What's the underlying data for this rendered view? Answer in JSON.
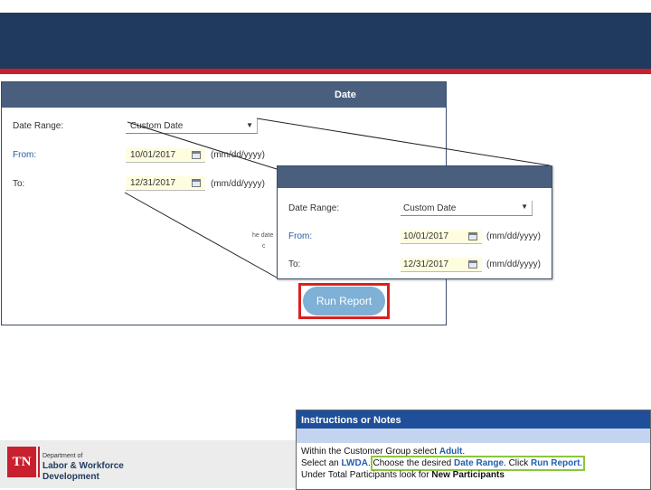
{
  "main_form": {
    "title": "Date",
    "date_range_label": "Date Range:",
    "date_range_value": "Custom Date",
    "from_label": "From:",
    "from_value": "10/01/2017",
    "to_label": "To:",
    "to_value": "12/31/2017",
    "date_format": "(mm/dd/yyyy)",
    "partial_text_1": "he date",
    "partial_text_2": "c"
  },
  "zoom_form": {
    "date_range_label": "Date Range:",
    "date_range_value": "Custom Date",
    "from_label": "From:",
    "from_value": "10/01/2017",
    "to_label": "To:",
    "to_value": "12/31/2017",
    "date_format": "(mm/dd/yyyy)"
  },
  "run_report_label": "Run Report",
  "logo": {
    "mark": "TN",
    "dept_small": "Department of",
    "dept_line1": "Labor & Workforce",
    "dept_line2": "Development"
  },
  "instructions": {
    "title": "Instructions or Notes",
    "l1_a": "Within the Customer Group select ",
    "l1_b": "Adult",
    "l1_c": ".",
    "l2_a": "Select an ",
    "l2_b": "LWDA",
    "l2_c": ". ",
    "l2_d": "Choose the desired ",
    "l2_e": "Date Range",
    "l2_f": ". Click ",
    "l2_g": "Run Report",
    "l2_h": ".",
    "l3_a": "Under Total Participants look for ",
    "l3_b": "New Participants"
  },
  "icons": [
    "calendar-icon",
    "chevron-down-icon"
  ],
  "colors": {
    "header": "#1f3a5c",
    "accent_red": "#c8202f",
    "panel_title": "#4a5f7e",
    "run_button": "#7fb0d6",
    "highlight_green": "#8cc63f"
  }
}
